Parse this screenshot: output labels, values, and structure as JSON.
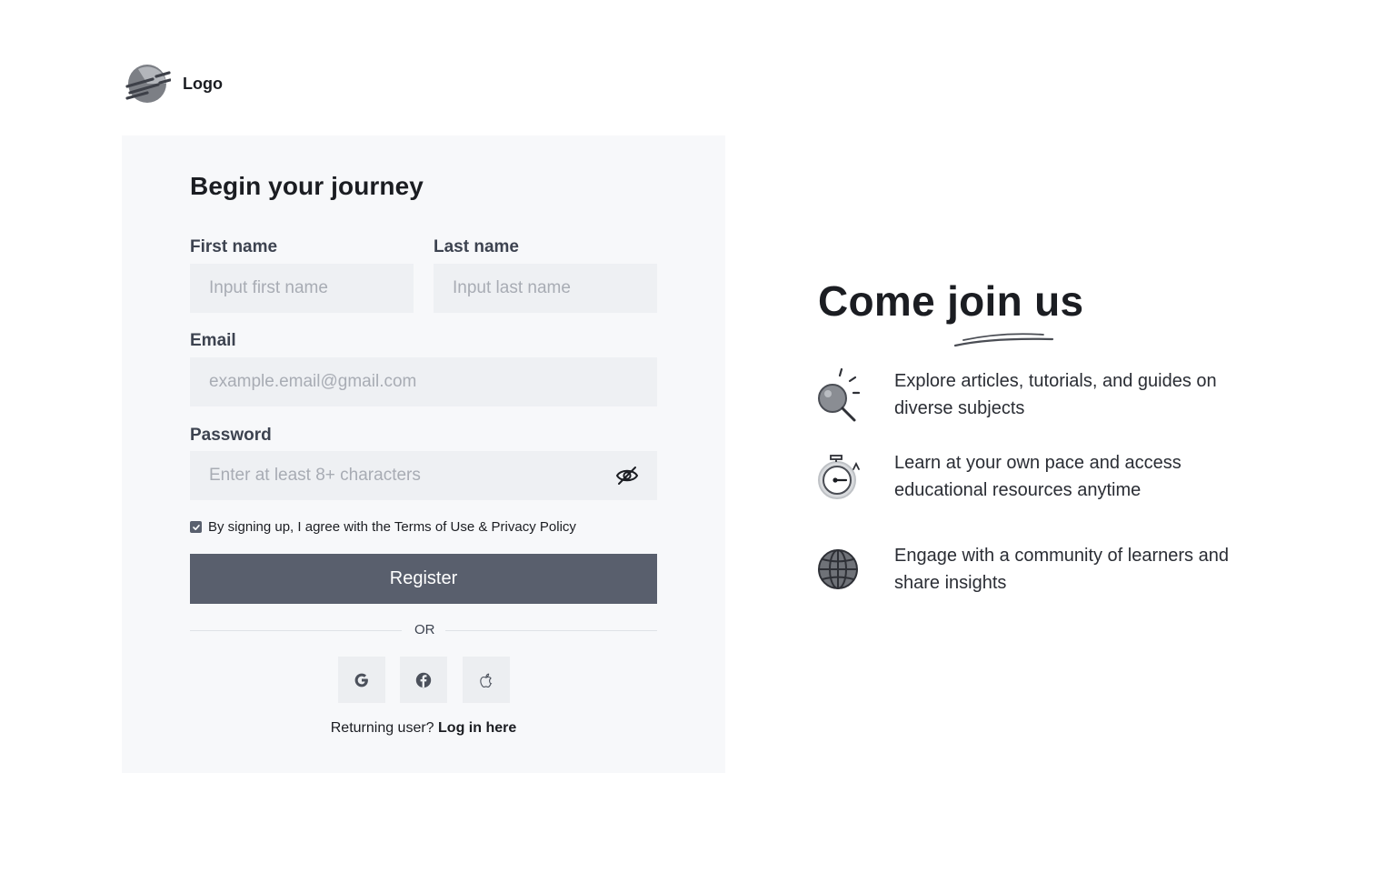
{
  "logo": {
    "text": "Logo",
    "icon": "logo-mark-icon"
  },
  "form": {
    "title": "Begin your journey",
    "first_name": {
      "label": "First name",
      "placeholder": "Input first name",
      "value": ""
    },
    "last_name": {
      "label": "Last name",
      "placeholder": "Input last name",
      "value": ""
    },
    "email": {
      "label": "Email",
      "placeholder": "example.email@gmail.com",
      "value": ""
    },
    "password": {
      "label": "Password",
      "placeholder": "Enter at least 8+ characters",
      "value": "",
      "icon": "eye-off-icon"
    },
    "terms": {
      "text": "By signing up, I agree with the Terms of Use & Privacy Policy",
      "checked": true
    },
    "register_label": "Register",
    "or_label": "OR",
    "social": [
      {
        "name": "google",
        "icon": "google-icon"
      },
      {
        "name": "facebook",
        "icon": "facebook-icon"
      },
      {
        "name": "apple",
        "icon": "apple-icon"
      }
    ],
    "returning_prefix": "Returning user? ",
    "login_link": "Log in here"
  },
  "promo": {
    "title": "Come join us",
    "features": [
      {
        "icon": "magnifier-icon",
        "text": "Explore articles, tutorials, and guides on diverse subjects"
      },
      {
        "icon": "stopwatch-icon",
        "text": "Learn at your own pace and access educational resources anytime"
      },
      {
        "icon": "globe-icon",
        "text": "Engage with a community of learners and share insights"
      }
    ]
  },
  "colors": {
    "card_bg": "#f7f8fa",
    "field_bg": "#eef0f3",
    "button_bg": "#595f6d",
    "text": "#1b1d22"
  }
}
